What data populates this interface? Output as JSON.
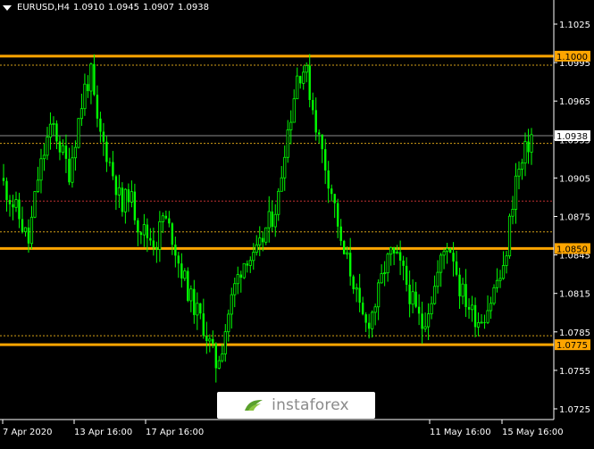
{
  "header": {
    "symbol": "EURUSD,H4",
    "open": "1.0910",
    "high": "1.0945",
    "low": "1.0907",
    "close": "1.0938"
  },
  "watermark": {
    "text": "instaforex"
  },
  "chart_data": {
    "type": "candlestick",
    "symbol": "EURUSD",
    "timeframe": "H4",
    "ylim": [
      1.0715,
      1.102
    ],
    "y_ticks": [
      "1.1025",
      "1.0995",
      "1.0965",
      "1.0935",
      "1.0905",
      "1.0875",
      "1.0845",
      "1.0815",
      "1.0785",
      "1.0755",
      "1.0725"
    ],
    "x_ticks": [
      "7 Apr 2020",
      "13 Apr 16:00",
      "17 Apr 16:00",
      "11 May 16:00",
      "15 May 16:00"
    ],
    "grid": false,
    "current_price": "1.0938",
    "levels": [
      {
        "label": "1.1000",
        "value": 1.1,
        "color": "#ffa500"
      },
      {
        "label": "1.0850",
        "value": 1.085,
        "color": "#ffa500"
      },
      {
        "label": "1.0775",
        "value": 1.0775,
        "color": "#ffa500"
      }
    ],
    "dotted_levels": [
      {
        "value": 1.0993,
        "color": "#d4a017"
      },
      {
        "value": 1.0932,
        "color": "#d4a017"
      },
      {
        "value": 1.0887,
        "color": "#c03030"
      },
      {
        "value": 1.0863,
        "color": "#d4a017"
      },
      {
        "value": 1.0782,
        "color": "#d4a017"
      }
    ],
    "bull_color": "#00ff00",
    "bear_color": "#00ff00",
    "close_path": [
      [
        0,
        1.09
      ],
      [
        4,
        1.088
      ],
      [
        8,
        1.0855
      ],
      [
        11,
        1.0905
      ],
      [
        14,
        1.0935
      ],
      [
        16,
        1.0945
      ],
      [
        18,
        1.093
      ],
      [
        21,
        1.091
      ],
      [
        24,
        1.095
      ],
      [
        26,
        1.0975
      ],
      [
        28,
        1.0985
      ],
      [
        30,
        1.0945
      ],
      [
        33,
        1.0925
      ],
      [
        36,
        1.09
      ],
      [
        38,
        1.088
      ],
      [
        40,
        1.0895
      ],
      [
        43,
        1.087
      ],
      [
        46,
        1.086
      ],
      [
        49,
        1.0855
      ],
      [
        51,
        1.0875
      ],
      [
        54,
        1.086
      ],
      [
        56,
        1.084
      ],
      [
        58,
        1.0825
      ],
      [
        60,
        1.081
      ],
      [
        62,
        1.08
      ],
      [
        64,
        1.079
      ],
      [
        66,
        1.0775
      ],
      [
        68,
        1.076
      ],
      [
        70,
        1.0775
      ],
      [
        72,
        1.08
      ],
      [
        74,
        1.082
      ],
      [
        76,
        1.0835
      ],
      [
        78,
        1.0845
      ],
      [
        80,
        1.084
      ],
      [
        82,
        1.085
      ],
      [
        84,
        1.0865
      ],
      [
        86,
        1.0875
      ],
      [
        88,
        1.089
      ],
      [
        90,
        1.093
      ],
      [
        92,
        1.0955
      ],
      [
        94,
        1.0985
      ],
      [
        96,
        1.099
      ],
      [
        97,
        1.0985
      ],
      [
        99,
        1.096
      ],
      [
        101,
        1.0935
      ],
      [
        103,
        1.0915
      ],
      [
        105,
        1.0895
      ],
      [
        107,
        1.087
      ],
      [
        108,
        1.085
      ],
      [
        110,
        1.084
      ],
      [
        112,
        1.0825
      ],
      [
        114,
        1.08
      ],
      [
        116,
        1.079
      ],
      [
        118,
        1.08
      ],
      [
        120,
        1.0815
      ],
      [
        122,
        1.0835
      ],
      [
        124,
        1.0845
      ],
      [
        126,
        1.084
      ],
      [
        128,
        1.083
      ],
      [
        130,
        1.0815
      ],
      [
        132,
        1.08
      ],
      [
        134,
        1.079
      ],
      [
        136,
        1.0805
      ],
      [
        138,
        1.082
      ],
      [
        140,
        1.084
      ],
      [
        142,
        1.0855
      ],
      [
        144,
        1.0845
      ],
      [
        146,
        1.082
      ],
      [
        148,
        1.081
      ],
      [
        150,
        1.08
      ],
      [
        152,
        1.0795
      ],
      [
        154,
        1.08
      ],
      [
        156,
        1.081
      ],
      [
        158,
        1.0825
      ],
      [
        160,
        1.083
      ],
      [
        162,
        1.087
      ],
      [
        164,
        1.0905
      ],
      [
        166,
        1.0915
      ],
      [
        167,
        1.0925
      ],
      [
        169,
        1.0938
      ]
    ]
  }
}
